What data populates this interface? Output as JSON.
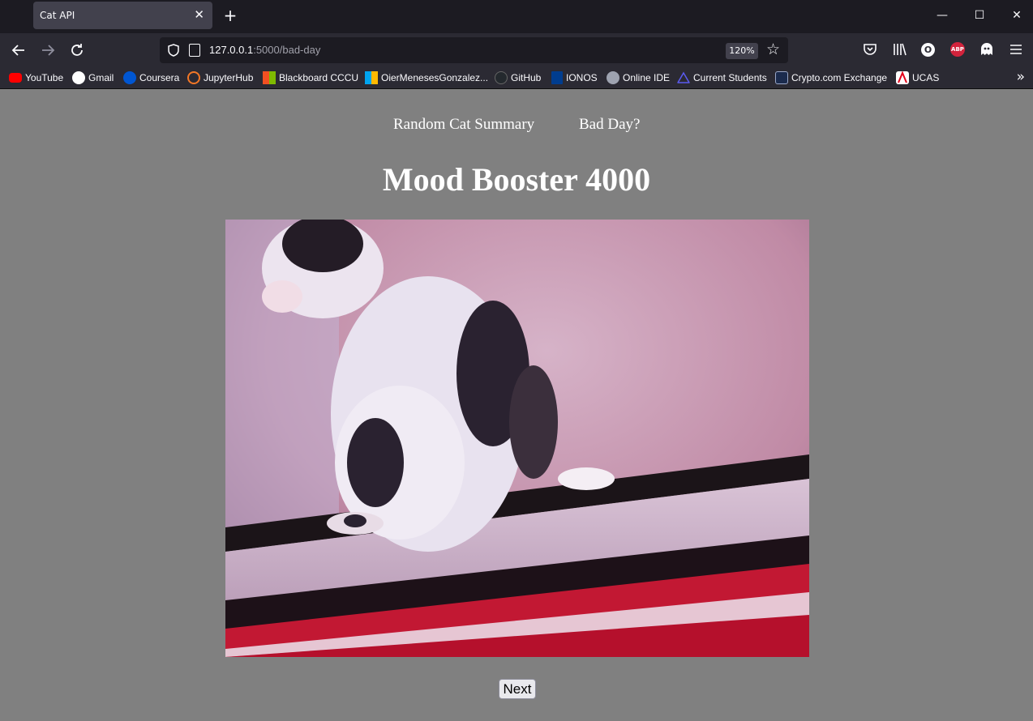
{
  "browser": {
    "tab_title": "Cat API",
    "tab_close": "✕",
    "new_tab": "+",
    "url_host": "127.0.0.1",
    "url_rest": ":5000/bad-day",
    "zoom": "120%",
    "window_controls": {
      "minimize": "—",
      "maximize": "☐",
      "close": "✕"
    }
  },
  "bookmarks": [
    {
      "label": "YouTube",
      "icon": "youtube-icon",
      "color": "#ff0000"
    },
    {
      "label": "Gmail",
      "icon": "google-icon",
      "color": "#ffffff"
    },
    {
      "label": "Coursera",
      "icon": "coursera-icon",
      "color": "#0056d2"
    },
    {
      "label": "JupyterHub",
      "icon": "jupyter-icon",
      "color": "#f37726"
    },
    {
      "label": "Blackboard CCCU",
      "icon": "microsoft-icon",
      "color": "#f25022"
    },
    {
      "label": "OierMenesesGonzalez...",
      "icon": "microsoft-icon",
      "color": "#7fba00"
    },
    {
      "label": "GitHub",
      "icon": "github-icon",
      "color": "#24292e"
    },
    {
      "label": "IONOS",
      "icon": "ionos-icon",
      "color": "#003d8f"
    },
    {
      "label": "Online IDE",
      "icon": "online-ide-icon",
      "color": "#9ea3b0"
    },
    {
      "label": "Current Students",
      "icon": "triangle-icon",
      "color": "#3b3bd6"
    },
    {
      "label": "Crypto.com Exchange",
      "icon": "crypto-icon",
      "color": "#1b2b4d"
    },
    {
      "label": "UCAS",
      "icon": "ucas-icon",
      "color": "#e3001b"
    }
  ],
  "page": {
    "nav": {
      "summary": "Random Cat Summary",
      "bad_day": "Bad Day?"
    },
    "title": "Mood Booster 4000",
    "next_label": "Next"
  }
}
